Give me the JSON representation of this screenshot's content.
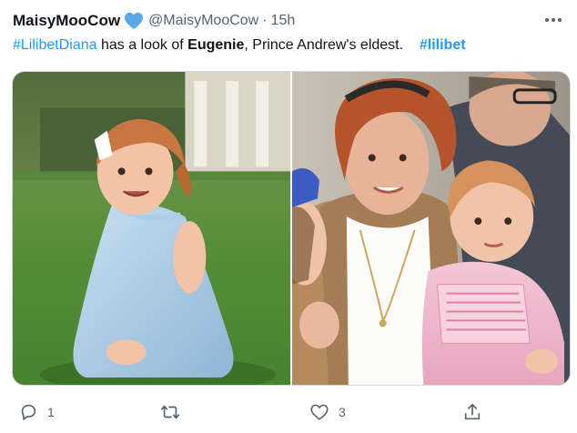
{
  "tweet": {
    "display_name": "MaisyMooCow",
    "verified_icon": "blue-heart-icon",
    "handle": "@MaisyMooCow",
    "separator": "·",
    "timestamp": "15h",
    "more_icon": "more-horizontal-icon",
    "text": {
      "hashtag1": "#LilibetDiana",
      "part1": " has a look of ",
      "bold": "Eugenie",
      "part2": ", Prince Andrew's eldest.",
      "hashtag2": "#lilibet"
    }
  },
  "media": {
    "left_photo": "baby-in-blue-dress-on-grass-photo",
    "right_photo": "woman-holding-baby-in-pink-dress-photo"
  },
  "actions": {
    "reply_count": "1",
    "retweet_count": "",
    "like_count": "3",
    "icons": [
      "reply-icon",
      "retweet-icon",
      "like-icon",
      "share-icon"
    ]
  },
  "colors": {
    "text": "#0f1419",
    "secondary": "#536471",
    "hashtag": "#1d9bf0",
    "heart": "#5aa9e6",
    "border": "#cfd9de"
  }
}
